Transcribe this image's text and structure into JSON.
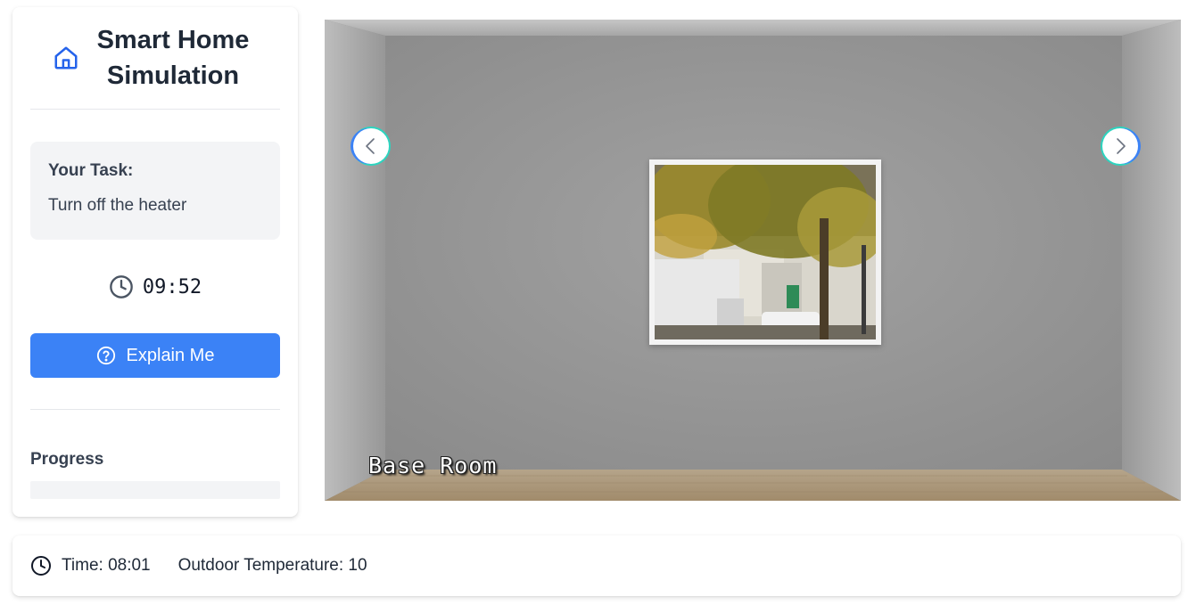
{
  "sidebar": {
    "title": "Smart Home Simulation",
    "task_heading": "Your Task:",
    "task_text": "Turn off the heater",
    "timer": "09:52",
    "explain_button": "Explain Me",
    "progress_label": "Progress",
    "progress_fraction": 0
  },
  "room": {
    "label": "Base Room"
  },
  "status": {
    "time": "Time: 08:01",
    "outdoor_temperature": "Outdoor Temperature: 10"
  },
  "icons": {
    "home": "home-icon",
    "clock": "clock-icon",
    "help": "help-circle-icon",
    "prev": "chevron-left-icon",
    "next": "chevron-right-icon"
  },
  "colors": {
    "accent": "#3b82f6",
    "nav_ring": "#2dd4bf",
    "panel_bg": "#f3f4f6"
  }
}
